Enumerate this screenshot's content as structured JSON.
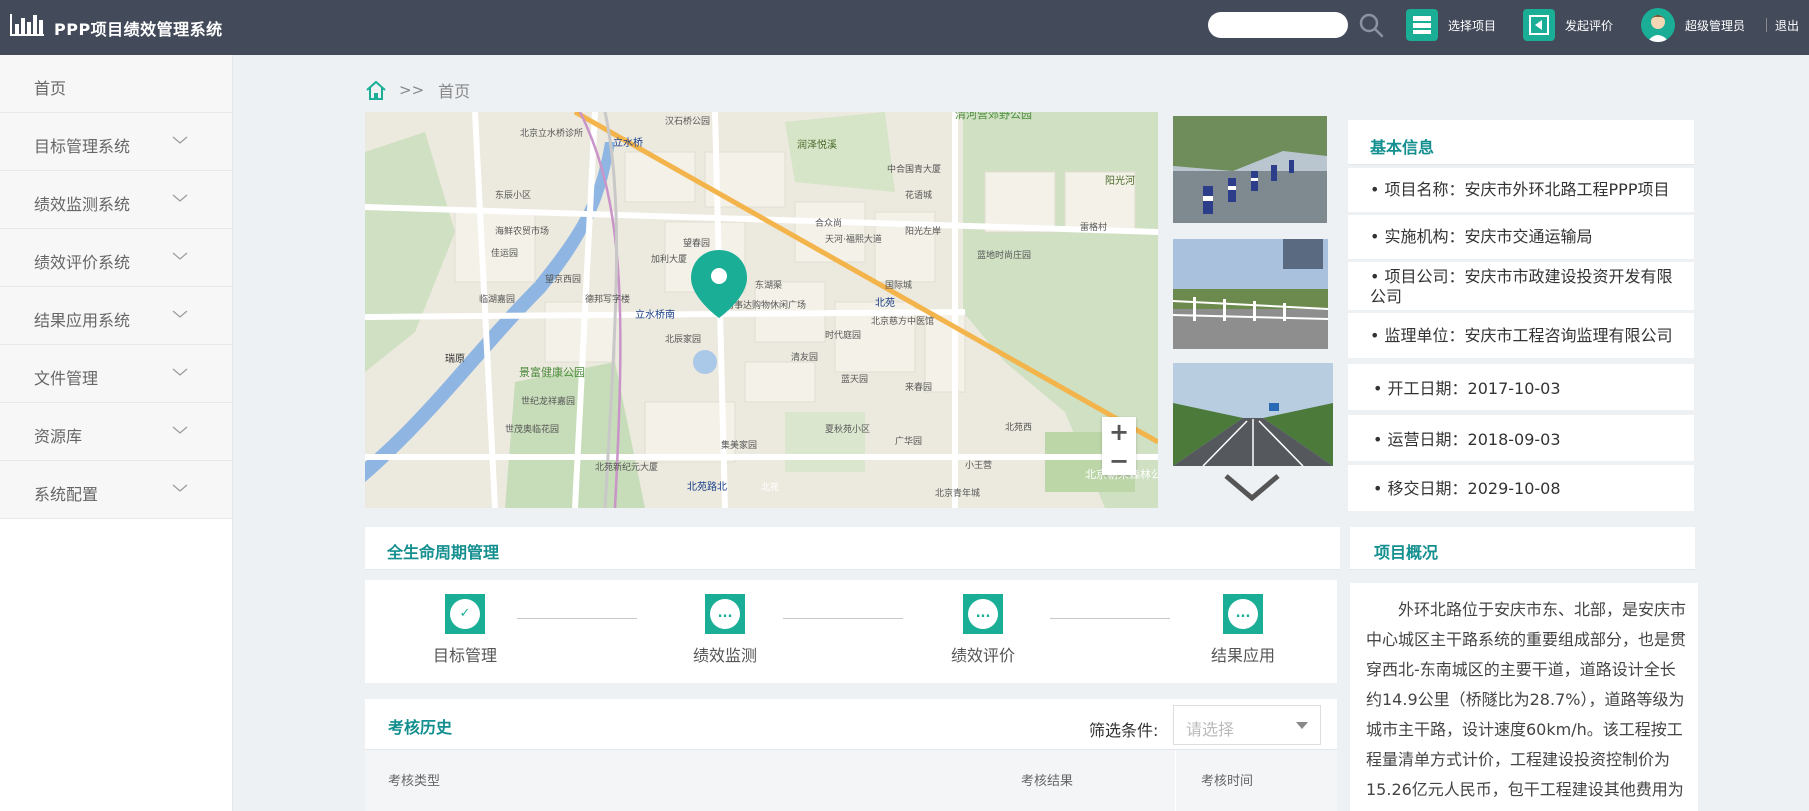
{
  "app": {
    "title": "PPP项目绩效管理系统"
  },
  "header": {
    "search_placeholder": "",
    "select_project": "选择项目",
    "start_evaluation": "发起评价",
    "user_name": "超级管理员",
    "logout": "退出"
  },
  "sidebar": {
    "items": [
      {
        "label": "首页",
        "expandable": false
      },
      {
        "label": "目标管理系统",
        "expandable": true
      },
      {
        "label": "绩效监测系统",
        "expandable": true
      },
      {
        "label": "绩效评价系统",
        "expandable": true
      },
      {
        "label": "结果应用系统",
        "expandable": true
      },
      {
        "label": "文件管理",
        "expandable": true
      },
      {
        "label": "资源库",
        "expandable": true
      },
      {
        "label": "系统配置",
        "expandable": true
      }
    ]
  },
  "breadcrumb": {
    "separator": ">>",
    "current": "首页"
  },
  "map": {
    "labels": [
      "汉石桥公园",
      "北京立水桥诊所",
      "立水桥",
      "润泽悦溪",
      "清河营郊野公园",
      "中合国青大厦",
      "阳光河",
      "东辰小区",
      "花语城",
      "海鲜农贸市场",
      "合众尚",
      "天河·福熙大道",
      "阳光左岸",
      "雷格村",
      "佳运园",
      "加利大厦",
      "望春园",
      "东湖渠",
      "蓝地时尚庄园",
      "望京西园",
      "临湖嘉园",
      "德邦写字楼",
      "立水桥南",
      "易事达购物休闲广场",
      "国际城",
      "北苑",
      "北京慈方中医馆",
      "北辰家园",
      "时代庭园",
      "瑞原",
      "景富健康公园",
      "清友园",
      "蓝天园",
      "来春园",
      "世纪龙祥嘉园",
      "世茂奥临花园",
      "夏秋苑小区",
      "广华园",
      "北苑西",
      "集美家园",
      "北苑新纪元大厦",
      "北苑路北",
      "北苑",
      "北京青年城",
      "小王营",
      "北京朝来森林公园"
    ],
    "zoom_in": "+",
    "zoom_out": "−"
  },
  "basic_info": {
    "title": "基本信息",
    "rows": [
      {
        "label": "项目名称",
        "value": "安庆市外环北路工程PPP项目"
      },
      {
        "label": "实施机构",
        "value": "安庆市交通运输局"
      },
      {
        "label": "项目公司",
        "value": "安庆市市政建设投资开发有限公司"
      },
      {
        "label": "监理单位",
        "value": "安庆市工程咨询监理有限公司"
      },
      {
        "label": "开工日期",
        "value": "2017-10-03"
      },
      {
        "label": "运营日期",
        "value": "2018-09-03"
      },
      {
        "label": "移交日期",
        "value": "2029-10-08"
      }
    ],
    "row_texts": [
      "• 项目名称：安庆市外环北路工程PPP项目",
      "• 实施机构：安庆市交通运输局",
      "• 项目公司：安庆市市政建设投资开发有限公司",
      "• 监理单位：安庆市工程咨询监理有限公司",
      "• 开工日期：2017-10-03",
      "• 运营日期：2018-09-03",
      "• 移交日期：2029-10-08"
    ]
  },
  "lifecycle": {
    "title": "全生命周期管理",
    "steps": [
      {
        "label": "目标管理",
        "status": "done",
        "mark": "✓"
      },
      {
        "label": "绩效监测",
        "status": "pending",
        "mark": "..."
      },
      {
        "label": "绩效评价",
        "status": "pending",
        "mark": "..."
      },
      {
        "label": "结果应用",
        "status": "pending",
        "mark": "..."
      }
    ]
  },
  "history": {
    "title": "考核历史",
    "filter_label": "筛选条件:",
    "filter_placeholder": "请选择",
    "columns": [
      "考核类型",
      "考核结果",
      "考核时间"
    ]
  },
  "overview": {
    "title": "项目概况",
    "text": "外环北路位于安庆市东、北部，是安庆市中心城区主干路系统的重要组成部分，也是贯穿西北-东南城区的主要干道，道路设计全长约14.9公里（桥隧比为28.7%），道路等级为城市主干路，设计速度60km/h。该工程按工程量清单方式计价，工程建设投资控制价为15.26亿元人民币，包干工程建设其他费用为"
  },
  "colors": {
    "topbar": "#434a5a",
    "accent": "#1aae97",
    "heading": "#148f8f",
    "page_bg": "#eef1f4"
  },
  "icons": [
    "bar-chart-logo-icon",
    "search-icon",
    "project-list-icon",
    "play-back-icon",
    "user-avatar-icon",
    "chevron-down-icon",
    "home-icon",
    "map-pin-icon",
    "check-icon",
    "ellipsis-icon",
    "dropdown-arrow-icon"
  ]
}
